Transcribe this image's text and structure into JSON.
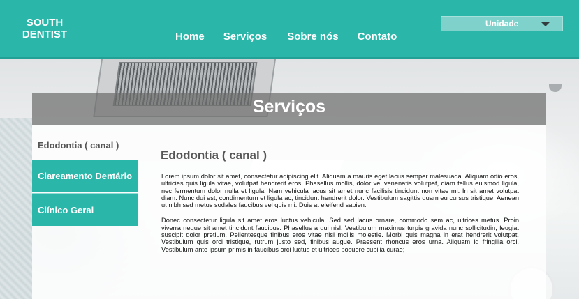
{
  "header": {
    "logo_text": "SOUTH DENTIST",
    "nav": {
      "home": "Home",
      "servicos": "Serviços",
      "sobre": "Sobre nós",
      "contato": "Contato"
    },
    "unit_select": {
      "value": "Unidade"
    }
  },
  "section": {
    "title": "Serviços"
  },
  "sidebar": {
    "current": "Edodontia ( canal )",
    "items": [
      {
        "label": "Clareamento Dentário"
      },
      {
        "label": "Clínico Geral"
      }
    ]
  },
  "article": {
    "title": "Edodontia ( canal )",
    "paragraphs": [
      "Lorem ipsum dolor sit amet, consectetur adipiscing elit. Aliquam a mauris eget lacus semper malesuada. Aliquam odio eros, ultricies quis ligula vitae, volutpat hendrerit eros. Phasellus mollis, dolor vel venenatis volutpat, diam tellus euismod ligula, nec fermentum dolor nulla et ligula. Nam vehicula lacus sit amet nunc facilisis tincidunt non vitae mi. In sit amet volutpat diam. Nunc dui est, condimentum et ligula ac, tincidunt hendrerit dolor. Vestibulum sagittis quam eu cursus tristique. Aenean ut nibh sed metus sodales faucibus vel quis mi. Duis at eleifend sapien.",
      "Donec consectetur ligula sit amet eros luctus vehicula. Sed sed lacus ornare, commodo sem ac, ultrices metus. Proin viverra neque sit amet tincidunt faucibus. Phasellus a dui nisl. Vestibulum maximus turpis gravida nunc sollicitudin, feugiat suscipit dolor pretium. Pellentesque finibus eros vitae nisi mollis molestie. Morbi quis magna in erat hendrerit volutpat. Vestibulum quis orci tristique, rutrum justo sed, finibus augue. Praesent rhoncus eros urna. Aliquam id fringilla orci. Vestibulum ante ipsum primis in faucibus orci luctus et ultrices posuere cubilia curae;"
    ]
  }
}
